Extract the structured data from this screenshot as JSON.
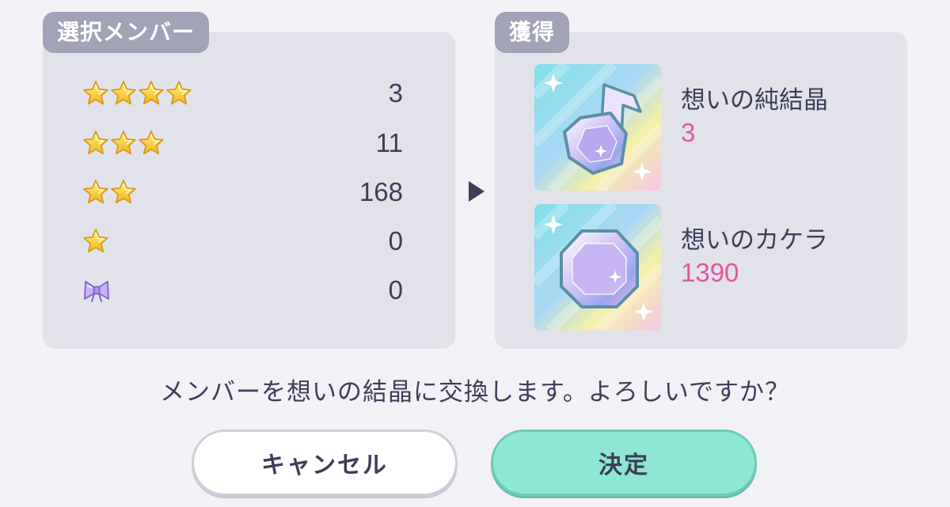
{
  "left_panel": {
    "title": "選択メンバー",
    "rows": [
      {
        "rarity": "4-star",
        "icon": "star-icon",
        "stars": 4,
        "count": "3"
      },
      {
        "rarity": "3-star",
        "icon": "star-icon",
        "stars": 3,
        "count": "11"
      },
      {
        "rarity": "2-star",
        "icon": "star-icon",
        "stars": 2,
        "count": "168"
      },
      {
        "rarity": "1-star",
        "icon": "star-icon",
        "stars": 1,
        "count": "0"
      },
      {
        "rarity": "bow",
        "icon": "bow-icon",
        "stars": 0,
        "count": "0"
      }
    ]
  },
  "right_panel": {
    "title": "獲得",
    "items": [
      {
        "name": "想いの純結晶",
        "qty": "3",
        "icon": "music-note-crystal-icon"
      },
      {
        "name": "想いのカケラ",
        "qty": "1390",
        "icon": "crystal-shard-icon"
      }
    ]
  },
  "message": "メンバーを想いの結晶に交換します。よろしいですか？",
  "buttons": {
    "cancel": "キャンセル",
    "confirm": "決定"
  },
  "colors": {
    "accent_qty": "#e0579f",
    "confirm_bg": "#8ee6d4",
    "panel_bg": "#e2e2eb",
    "tab_bg": "#a3a3b7",
    "star": "#f6c93b"
  }
}
